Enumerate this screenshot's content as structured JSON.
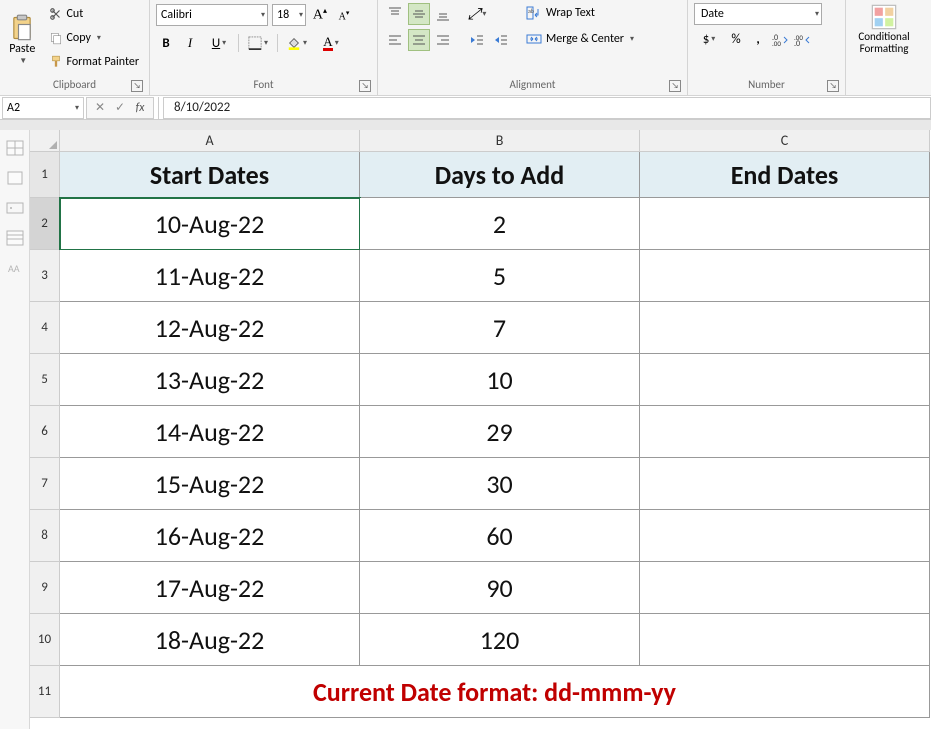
{
  "ribbon": {
    "clipboard": {
      "paste": "Paste",
      "cut": "Cut",
      "copy": "Copy",
      "format_painter": "Format Painter",
      "label": "Clipboard"
    },
    "font": {
      "name": "Calibri",
      "size": "18",
      "label": "Font"
    },
    "alignment": {
      "wrap": "Wrap Text",
      "merge": "Merge & Center",
      "label": "Alignment"
    },
    "number": {
      "format": "Date",
      "label": "Number"
    },
    "styles": {
      "cond": "Conditional Formatting"
    }
  },
  "namebox": "A2",
  "formula": "8/10/2022",
  "columns": [
    "A",
    "B",
    "C"
  ],
  "headers": {
    "A": "Start Dates",
    "B": "Days to Add",
    "C": "End Dates"
  },
  "rows": [
    {
      "n": "2",
      "A": "10-Aug-22",
      "B": "2",
      "C": ""
    },
    {
      "n": "3",
      "A": "11-Aug-22",
      "B": "5",
      "C": ""
    },
    {
      "n": "4",
      "A": "12-Aug-22",
      "B": "7",
      "C": ""
    },
    {
      "n": "5",
      "A": "13-Aug-22",
      "B": "10",
      "C": ""
    },
    {
      "n": "6",
      "A": "14-Aug-22",
      "B": "29",
      "C": ""
    },
    {
      "n": "7",
      "A": "15-Aug-22",
      "B": "30",
      "C": ""
    },
    {
      "n": "8",
      "A": "16-Aug-22",
      "B": "60",
      "C": ""
    },
    {
      "n": "9",
      "A": "17-Aug-22",
      "B": "90",
      "C": ""
    },
    {
      "n": "10",
      "A": "18-Aug-22",
      "B": "120",
      "C": ""
    }
  ],
  "note_row": "11",
  "note": "Current Date format: dd-mmm-yy",
  "chart_data": {
    "type": "table",
    "columns": [
      "Start Dates",
      "Days to Add",
      "End Dates"
    ],
    "rows": [
      [
        "10-Aug-22",
        2,
        ""
      ],
      [
        "11-Aug-22",
        5,
        ""
      ],
      [
        "12-Aug-22",
        7,
        ""
      ],
      [
        "13-Aug-22",
        10,
        ""
      ],
      [
        "14-Aug-22",
        29,
        ""
      ],
      [
        "15-Aug-22",
        30,
        ""
      ],
      [
        "16-Aug-22",
        60,
        ""
      ],
      [
        "17-Aug-22",
        90,
        ""
      ],
      [
        "18-Aug-22",
        120,
        ""
      ]
    ]
  }
}
